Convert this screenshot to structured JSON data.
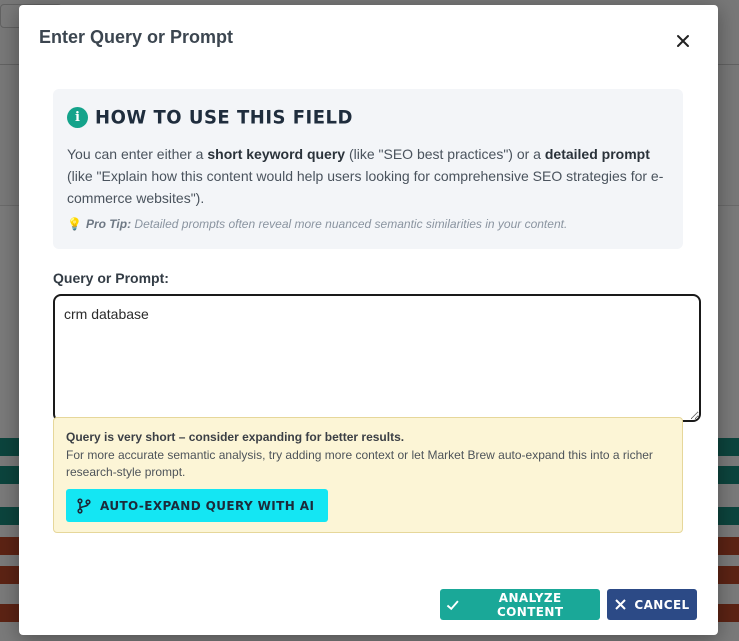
{
  "modal": {
    "title": "Enter Query or Prompt",
    "help": {
      "title": "How to use this field",
      "text_1": "You can enter either a ",
      "bold_1": "short keyword query",
      "text_2": " (like \"SEO best practices\") or a ",
      "bold_2": "detailed prompt",
      "text_3": " (like \"Explain how this content would help users looking for comprehensive SEO strategies for e-commerce websites\").",
      "tip_label": "Pro Tip:",
      "tip_text": " Detailed prompts often reveal more nuanced semantic similarities in your content."
    },
    "field_label": "Query or Prompt:",
    "query_value": "crm database",
    "warning": {
      "title": "Query is very short – consider expanding for better results.",
      "text": "For more accurate semantic analysis, try adding more context or let Market Brew auto-expand this into a richer research-style prompt.",
      "expand_button": "Auto-Expand Query with AI"
    },
    "analyze_button": "Analyze Content",
    "cancel_button": "Cancel"
  },
  "colors": {
    "accent_teal": "#1aa898",
    "cancel_blue": "#2c4a86",
    "expand_cyan": "#14e6f3",
    "warning_bg": "#fcf5d6"
  }
}
